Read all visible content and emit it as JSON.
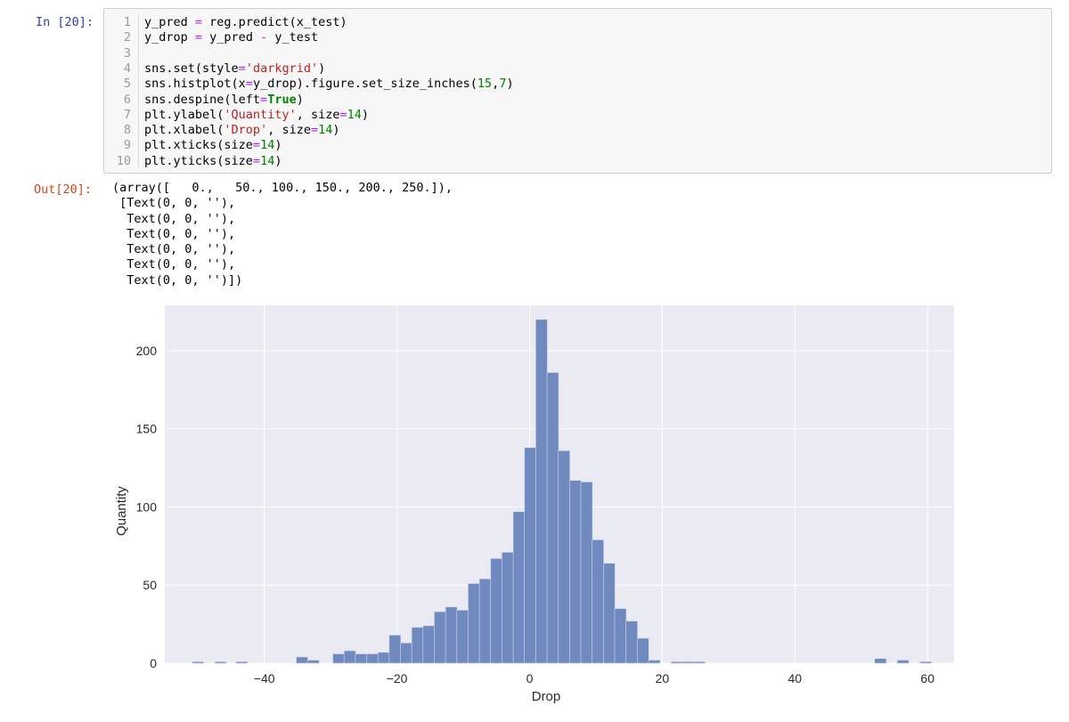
{
  "input_prompt": "In [20]:",
  "output_prompt": "Out[20]:",
  "code_lines": [
    {
      "n": "1",
      "parts": [
        [
          "t",
          "y_pred "
        ],
        [
          "o",
          "="
        ],
        [
          "t",
          " reg.predict(x_test)"
        ]
      ]
    },
    {
      "n": "2",
      "parts": [
        [
          "t",
          "y_drop "
        ],
        [
          "o",
          "="
        ],
        [
          "t",
          " y_pred "
        ],
        [
          "o",
          "-"
        ],
        [
          "t",
          " y_test"
        ]
      ]
    },
    {
      "n": "3",
      "parts": []
    },
    {
      "n": "4",
      "parts": [
        [
          "t",
          "sns.set(style"
        ],
        [
          "o",
          "="
        ],
        [
          "s",
          "'darkgrid'"
        ],
        [
          "t",
          ")"
        ]
      ]
    },
    {
      "n": "5",
      "parts": [
        [
          "t",
          "sns.histplot(x"
        ],
        [
          "o",
          "="
        ],
        [
          "t",
          "y_drop).figure.set_size_inches("
        ],
        [
          "n",
          "15"
        ],
        [
          "t",
          ","
        ],
        [
          "n",
          "7"
        ],
        [
          "t",
          ")"
        ]
      ]
    },
    {
      "n": "6",
      "parts": [
        [
          "t",
          "sns.despine(left"
        ],
        [
          "o",
          "="
        ],
        [
          "k",
          "True"
        ],
        [
          "t",
          ")"
        ]
      ]
    },
    {
      "n": "7",
      "parts": [
        [
          "t",
          "plt.ylabel("
        ],
        [
          "s",
          "'Quantity'"
        ],
        [
          "t",
          ", size"
        ],
        [
          "o",
          "="
        ],
        [
          "n",
          "14"
        ],
        [
          "t",
          ")"
        ]
      ]
    },
    {
      "n": "8",
      "parts": [
        [
          "t",
          "plt.xlabel("
        ],
        [
          "s",
          "'Drop'"
        ],
        [
          "t",
          ", size"
        ],
        [
          "o",
          "="
        ],
        [
          "n",
          "14"
        ],
        [
          "t",
          ")"
        ]
      ]
    },
    {
      "n": "9",
      "parts": [
        [
          "t",
          "plt.xticks(size"
        ],
        [
          "o",
          "="
        ],
        [
          "n",
          "14"
        ],
        [
          "t",
          ")"
        ]
      ]
    },
    {
      "n": "10",
      "parts": [
        [
          "t",
          "plt.yticks(size"
        ],
        [
          "o",
          "="
        ],
        [
          "n",
          "14"
        ],
        [
          "t",
          ")"
        ]
      ]
    }
  ],
  "output_lines": [
    "(array([   0.,   50., 100., 150., 200., 250.]),",
    " [Text(0, 0, ''),",
    "  Text(0, 0, ''),",
    "  Text(0, 0, ''),",
    "  Text(0, 0, ''),",
    "  Text(0, 0, ''),",
    "  Text(0, 0, '')])"
  ],
  "chart_data": {
    "type": "bar",
    "style": "darkgrid",
    "title": "",
    "xlabel": "Drop",
    "ylabel": "Quantity",
    "xlim": [
      -55,
      64
    ],
    "ylim": [
      0,
      229
    ],
    "xticks": [
      -40,
      -20,
      0,
      20,
      40,
      60
    ],
    "yticks": [
      0,
      50,
      100,
      150,
      200
    ],
    "bin_width": 1.75,
    "bins_start": -50.4,
    "counts": [
      1,
      0,
      0,
      1,
      0,
      0,
      1,
      0,
      0,
      0,
      0,
      0,
      0,
      0,
      0,
      0,
      0,
      0,
      0,
      0,
      0,
      0,
      0,
      0,
      0,
      0,
      0,
      0,
      0,
      0,
      0,
      0,
      0,
      0,
      0,
      0,
      0,
      0,
      0,
      0,
      0,
      0,
      0,
      0,
      0,
      0,
      0,
      0,
      0,
      0,
      0,
      0,
      0,
      0,
      0,
      0,
      0,
      0,
      0,
      0,
      0,
      0,
      0,
      0,
      0,
      0,
      0,
      0,
      0
    ],
    "bars": [
      {
        "x": -50.0,
        "y": 1
      },
      {
        "x": -46.6,
        "y": 1
      },
      {
        "x": -43.4,
        "y": 1
      },
      {
        "x": -34.3,
        "y": 4
      },
      {
        "x": -32.6,
        "y": 2
      },
      {
        "x": -28.8,
        "y": 6
      },
      {
        "x": -27.1,
        "y": 8
      },
      {
        "x": -25.4,
        "y": 6
      },
      {
        "x": -23.7,
        "y": 6
      },
      {
        "x": -22.0,
        "y": 7
      },
      {
        "x": -20.3,
        "y": 18
      },
      {
        "x": -18.6,
        "y": 13
      },
      {
        "x": -16.9,
        "y": 23
      },
      {
        "x": -15.2,
        "y": 24
      },
      {
        "x": -13.5,
        "y": 33
      },
      {
        "x": -11.8,
        "y": 36
      },
      {
        "x": -10.1,
        "y": 34
      },
      {
        "x": -8.4,
        "y": 51
      },
      {
        "x": -6.7,
        "y": 54
      },
      {
        "x": -5.0,
        "y": 67
      },
      {
        "x": -3.3,
        "y": 71
      },
      {
        "x": -1.6,
        "y": 97
      },
      {
        "x": 0.1,
        "y": 138
      },
      {
        "x": 1.8,
        "y": 220
      },
      {
        "x": 3.5,
        "y": 186
      },
      {
        "x": 5.2,
        "y": 136
      },
      {
        "x": 6.9,
        "y": 117
      },
      {
        "x": 8.6,
        "y": 116
      },
      {
        "x": 10.3,
        "y": 79
      },
      {
        "x": 12.0,
        "y": 64
      },
      {
        "x": 13.7,
        "y": 35
      },
      {
        "x": 15.4,
        "y": 27
      },
      {
        "x": 17.1,
        "y": 16
      },
      {
        "x": 18.8,
        "y": 2
      },
      {
        "x": 22.2,
        "y": 1
      },
      {
        "x": 23.9,
        "y": 1
      },
      {
        "x": 25.6,
        "y": 1
      },
      {
        "x": 52.9,
        "y": 3
      },
      {
        "x": 56.3,
        "y": 2
      },
      {
        "x": 59.7,
        "y": 1
      }
    ],
    "bar_color": "#7089bf",
    "bar_edge": "#d7dceb",
    "background": "#eaeaf2",
    "grid_color": "#ffffff"
  }
}
